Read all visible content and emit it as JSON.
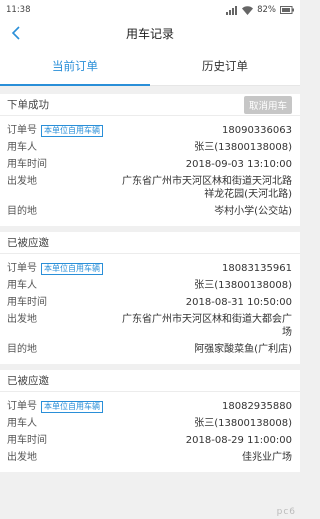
{
  "status_bar": {
    "time": "11:38",
    "battery": "82%"
  },
  "header": {
    "title": "用车记录"
  },
  "tabs": [
    {
      "label": "当前订单",
      "active": true
    },
    {
      "label": "历史订单",
      "active": false
    }
  ],
  "labels": {
    "order_no": "订单号",
    "user": "用车人",
    "time": "用车时间",
    "origin": "出发地",
    "destination": "目的地"
  },
  "orders": [
    {
      "status": "下单成功",
      "action": "取消用车",
      "tag": "本单位自用车辆",
      "order_no": "18090336063",
      "user": "张三(13800138008)",
      "time": "2018-09-03 13:10:00",
      "origin": "广东省广州市天河区林和街道天河北路祥龙花园(天河北路)",
      "destination": "岑村小学(公交站)"
    },
    {
      "status": "已被应邀",
      "tag": "本单位自用车辆",
      "order_no": "18083135961",
      "user": "张三(13800138008)",
      "time": "2018-08-31 10:50:00",
      "origin": "广东省广州市天河区林和街道大都会广场",
      "destination": "阿强家酸菜鱼(广利店)"
    },
    {
      "status": "已被应邀",
      "tag": "本单位自用车辆",
      "order_no": "18082935880",
      "user": "张三(13800138008)",
      "time": "2018-08-29 11:00:00",
      "origin": "",
      "destination": "佳兆业广场"
    }
  ],
  "watermark": "pc6"
}
